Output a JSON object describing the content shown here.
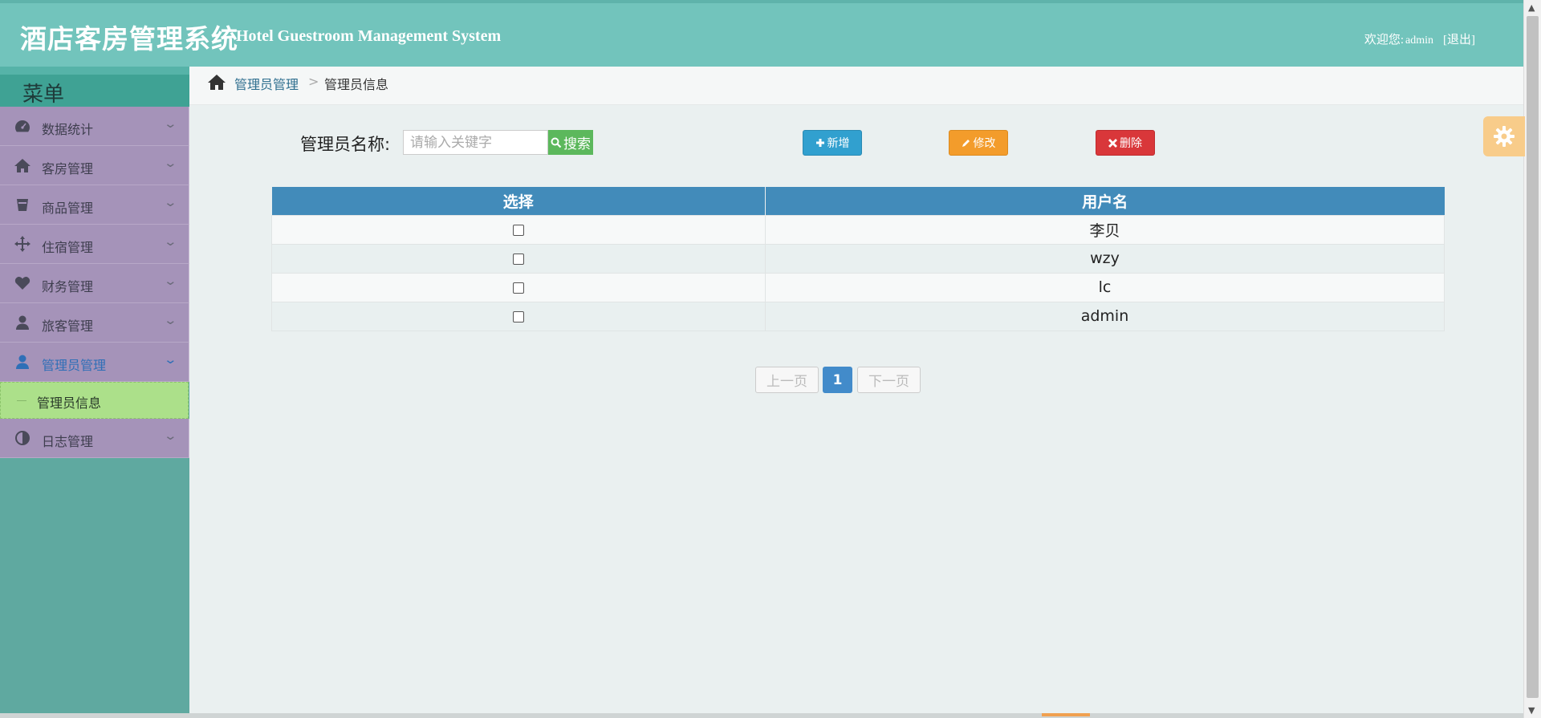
{
  "header": {
    "title_cn": "酒店客房管理系统",
    "title_en": "Hotel Guestroom Management System",
    "welcome_prefix": "欢迎您:",
    "username": "admin",
    "logout": "[退出]"
  },
  "sidebar": {
    "menu_title": "菜单",
    "items": [
      {
        "label": "数据统计",
        "icon": "dashboard-icon"
      },
      {
        "label": "客房管理",
        "icon": "home-icon"
      },
      {
        "label": "商品管理",
        "icon": "cup-icon"
      },
      {
        "label": "住宿管理",
        "icon": "move-icon"
      },
      {
        "label": "财务管理",
        "icon": "heart-icon"
      },
      {
        "label": "旅客管理",
        "icon": "user-icon"
      },
      {
        "label": "管理员管理",
        "icon": "user-icon"
      },
      {
        "label": "日志管理",
        "icon": "contrast-icon"
      }
    ],
    "active_item": "管理员管理",
    "sub_item": "管理员信息"
  },
  "breadcrumb": {
    "home_icon": "home-icon",
    "parent": "管理员管理",
    "separator": ">",
    "current": "管理员信息"
  },
  "search": {
    "label": "管理员名称:",
    "placeholder": "请输入关键字",
    "button": "搜索"
  },
  "actions": {
    "add": "新增",
    "edit": "修改",
    "delete": "删除"
  },
  "table": {
    "headers": [
      "选择",
      "用户名"
    ],
    "rows": [
      "李贝",
      "wzy",
      "lc",
      "admin"
    ]
  },
  "pagination": {
    "prev": "上一页",
    "current": "1",
    "next": "下一页"
  },
  "colors": {
    "header": "#72c4bc",
    "sidebar_item": "#a593b9",
    "active_sub": "#ace08a",
    "table_header": "#428bba",
    "add_btn": "#31a0cf",
    "edit_btn": "#f39c2b",
    "delete_btn": "#d9373a",
    "search_btn": "#5cb85c"
  }
}
